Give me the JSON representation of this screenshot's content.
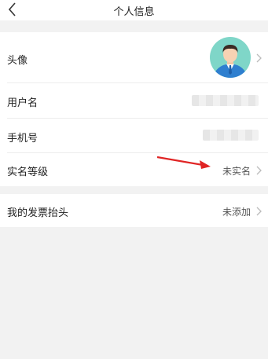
{
  "header": {
    "title": "个人信息"
  },
  "profile": {
    "avatar_label": "头像",
    "username_label": "用户名",
    "phone_label": "手机号",
    "verify_label": "实名等级",
    "verify_value": "未实名"
  },
  "invoice": {
    "label": "我的发票抬头",
    "value": "未添加"
  },
  "colors": {
    "accent_arrow": "#e02424",
    "avatar_bg": "#7fd6c8",
    "suit": "#2f7fcf"
  },
  "icons": [
    "back-arrow-icon",
    "chevron-right-icon",
    "avatar-icon",
    "annotation-arrow"
  ]
}
